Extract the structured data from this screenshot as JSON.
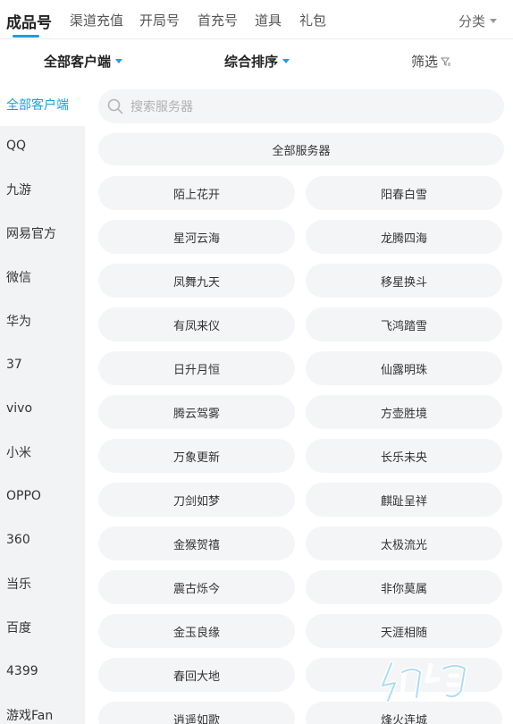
{
  "tabs": [
    "成品号",
    "渠道充值",
    "开局号",
    "首充号",
    "道具",
    "礼包"
  ],
  "category_label": "分类",
  "filters": {
    "client": "全部客户端",
    "sort": "综合排序",
    "screen": "筛选"
  },
  "sidebar": [
    "全部客户端",
    "QQ",
    "九游",
    "网易官方",
    "微信",
    "华为",
    "37",
    "vivo",
    "小米",
    "OPPO",
    "360",
    "当乐",
    "百度",
    "4399",
    "游戏Fan"
  ],
  "search_placeholder": "搜索服务器",
  "all_servers": "全部服务器",
  "servers": [
    "陌上花开",
    "阳春白雪",
    "星河云海",
    "龙腾四海",
    "凤舞九天",
    "移星换斗",
    "有凤来仪",
    "飞鸿踏雪",
    "日升月恒",
    "仙露明珠",
    "腾云驾雾",
    "方壶胜境",
    "万象更新",
    "长乐未央",
    "刀剑如梦",
    "麒趾呈祥",
    "金猴贺禧",
    "太极流光",
    "震古烁今",
    "非你莫属",
    "金玉良缘",
    "天涯相随",
    "春回大地",
    "",
    "逍遥如歌",
    "烽火连城"
  ],
  "icons": {
    "search": "search-icon",
    "filter": "filter-icon",
    "dropdown": "chevron-down-icon"
  },
  "colors": {
    "accent": "#1a9fe0",
    "sidebar_bg": "#f2f3f5",
    "pill_bg": "#f4f5f7"
  }
}
